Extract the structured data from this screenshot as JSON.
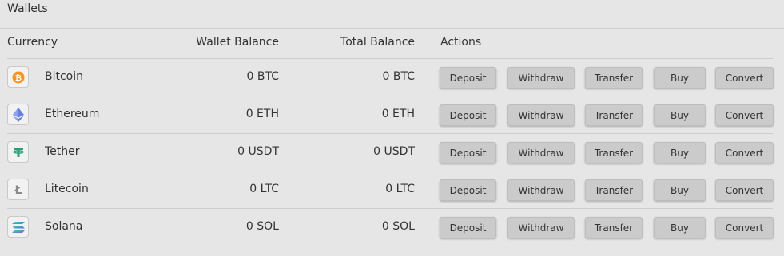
{
  "panel": {
    "title": "Wallets"
  },
  "columns": {
    "currency": "Currency",
    "wallet_balance": "Wallet Balance",
    "total_balance": "Total Balance",
    "actions": "Actions"
  },
  "actions": {
    "deposit": "Deposit",
    "withdraw": "Withdraw",
    "transfer": "Transfer",
    "buy": "Buy",
    "convert": "Convert"
  },
  "rows": [
    {
      "name": "Bitcoin",
      "icon": "bitcoin-icon",
      "wallet_balance": "0 BTC",
      "total_balance": "0 BTC"
    },
    {
      "name": "Ethereum",
      "icon": "ethereum-icon",
      "wallet_balance": "0 ETH",
      "total_balance": "0 ETH"
    },
    {
      "name": "Tether",
      "icon": "tether-icon",
      "wallet_balance": "0 USDT",
      "total_balance": "0 USDT"
    },
    {
      "name": "Litecoin",
      "icon": "litecoin-icon",
      "wallet_balance": "0 LTC",
      "total_balance": "0 LTC"
    },
    {
      "name": "Solana",
      "icon": "solana-icon",
      "wallet_balance": "0 SOL",
      "total_balance": "0 SOL"
    }
  ],
  "colors": {
    "background": "#e6e6e6",
    "button": "#cbcbcb",
    "bitcoin": "#f7931a",
    "ethereum": "#627eea",
    "tether": "#26a17b",
    "litecoin": "#8a8a8a",
    "solana_a": "#9945ff",
    "solana_b": "#14f195"
  }
}
